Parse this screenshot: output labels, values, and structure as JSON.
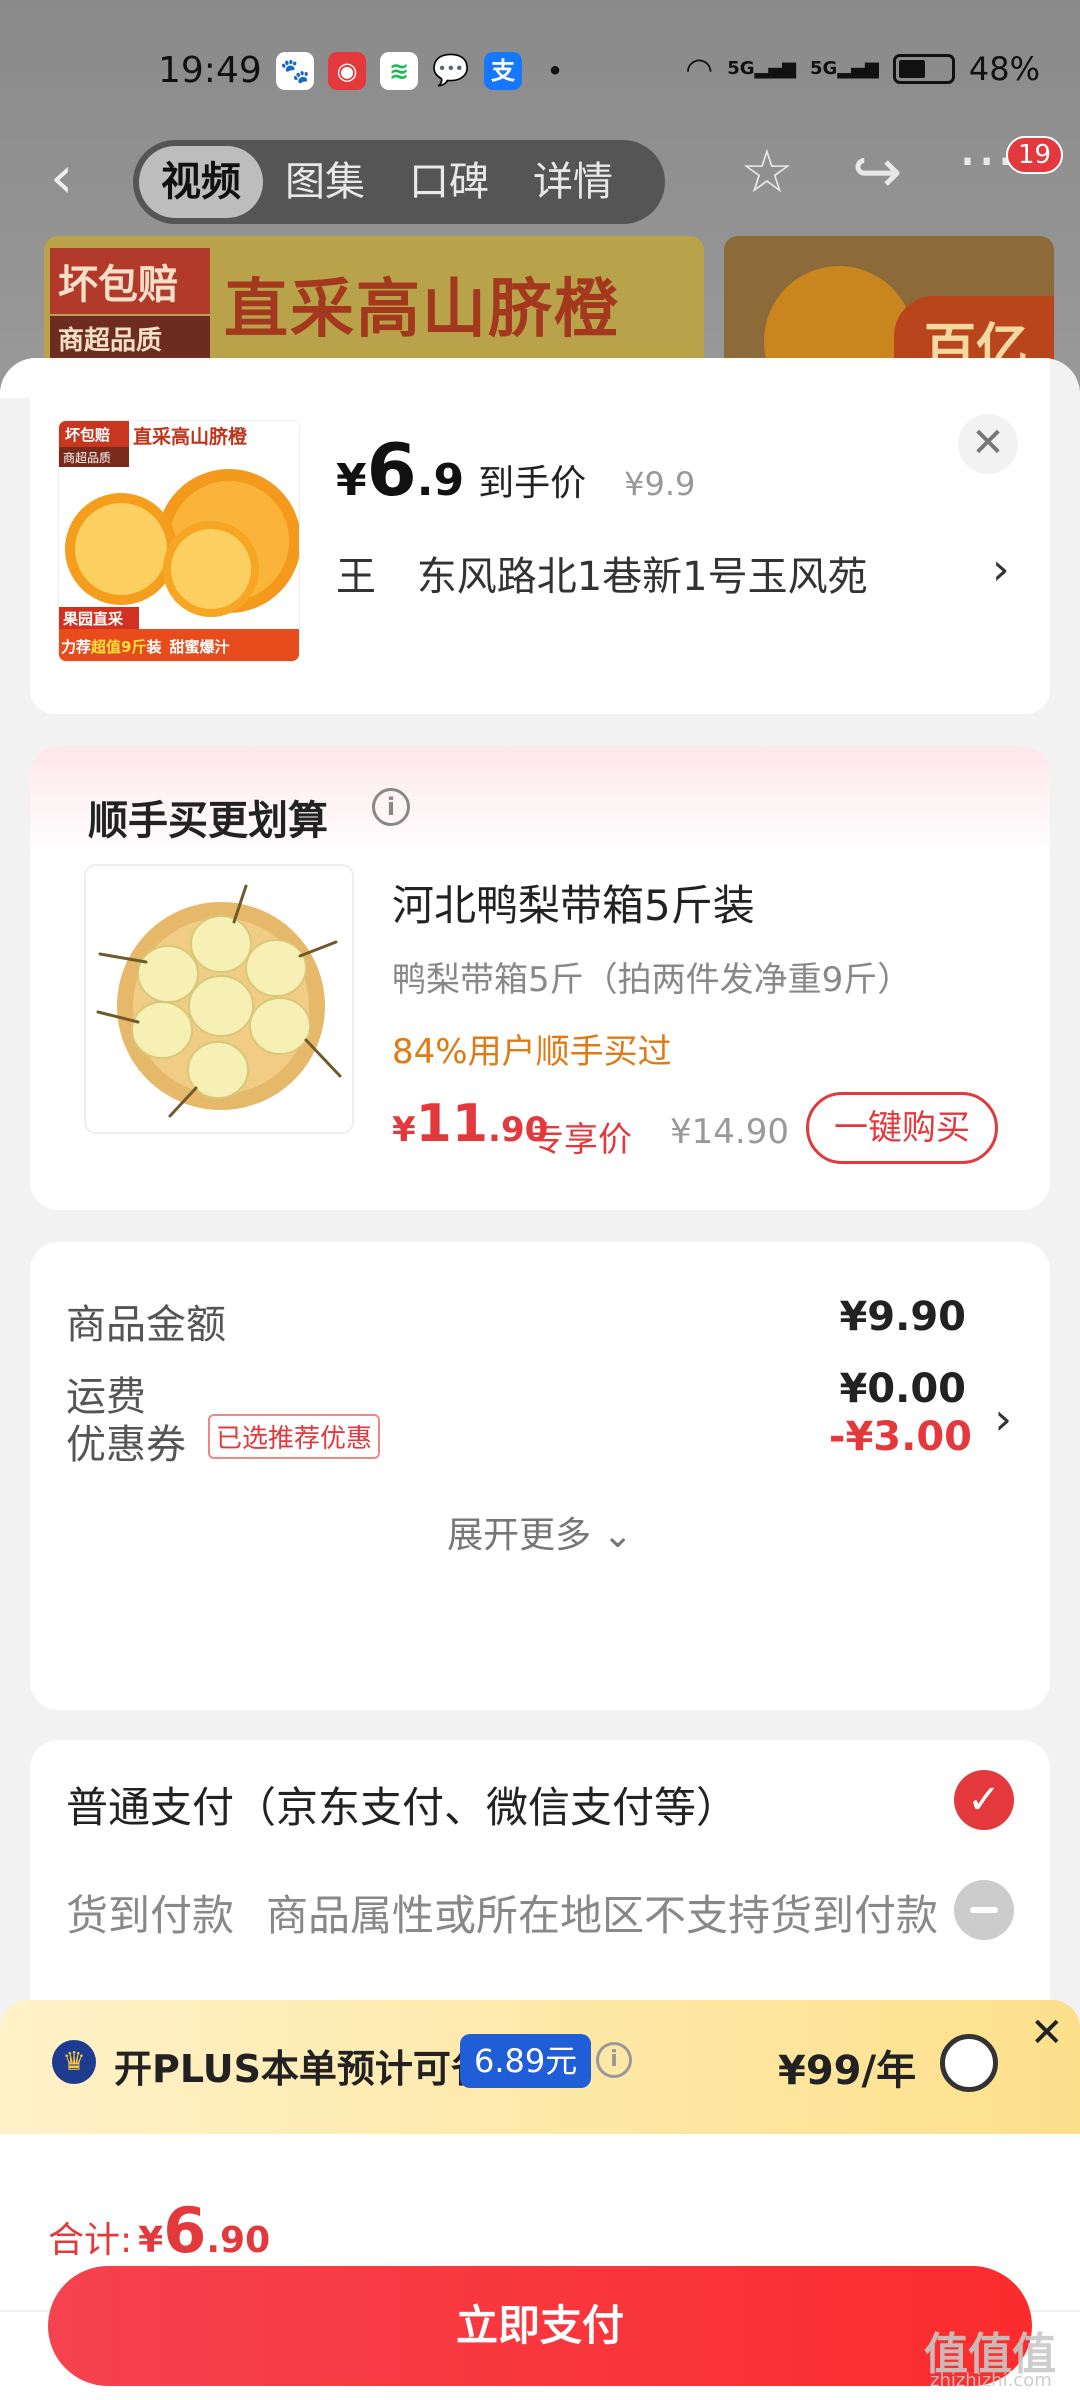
{
  "status_bar": {
    "time": "19:49",
    "battery": "48%",
    "signal_1": "5G",
    "signal_2": "5G"
  },
  "top_nav": {
    "tabs": [
      "视频",
      "图集",
      "口碑",
      "详情"
    ],
    "active_tab": "视频",
    "badge_count": "19"
  },
  "banner": {
    "tag_1": "坏包赔",
    "tag_2": "商超品质",
    "headline": "直采高山脐橙",
    "side_tag": "百亿"
  },
  "header": {
    "currency": "¥",
    "price_int": "6",
    "price_dec": ".9",
    "price_label": "到手价",
    "original_price": "¥9.9",
    "recipient": "王",
    "address": "东风路北1巷新1号玉风苑",
    "thumb_text": {
      "tag_1": "坏包赔",
      "tag_2": "商超品质",
      "headline": "直采高山脐橙",
      "badge_1": "果园直采",
      "slogan_1": "力荐",
      "slogan_highlight": "超值9斤",
      "slogan_2": "装",
      "slogan_3": "甜蜜爆汁"
    }
  },
  "addon": {
    "title": "顺手买更划算",
    "name": "河北鸭梨带箱5斤装",
    "spec": "鸭梨带箱5斤（拍两件发净重9斤）",
    "stat": "84%用户顺手买过",
    "currency": "¥",
    "price_int": "11",
    "price_dec": ".90",
    "price_label": "专享价",
    "original_price": "¥14.90",
    "buy_label": "一键购买"
  },
  "details": {
    "rows": [
      {
        "label": "商品金额",
        "value": "¥9.90"
      },
      {
        "label": "运费",
        "value": "¥0.00"
      },
      {
        "label": "优惠券",
        "value": "-¥3.00"
      }
    ],
    "coupon_tag": "已选推荐优惠",
    "expand_label": "展开更多"
  },
  "payment": {
    "normal_label": "普通支付（京东支付、微信支付等）",
    "cod_label": "货到付款",
    "cod_note": "商品属性或所在地区不支持货到付款"
  },
  "plus": {
    "text": "开PLUS本单预计可省",
    "save_amount": "6.89元",
    "price": "¥99/年"
  },
  "footer": {
    "total_label": "合计:",
    "currency": "¥",
    "total_int": "6",
    "total_dec": ".90",
    "pay_label": "立即支付"
  },
  "watermark": {
    "logo": "值值值",
    "site": "zhizhizhi.com"
  },
  "colors": {
    "accent": "#e4393c",
    "plus_blue": "#1f5ed6",
    "orange_text": "#e07a14"
  }
}
